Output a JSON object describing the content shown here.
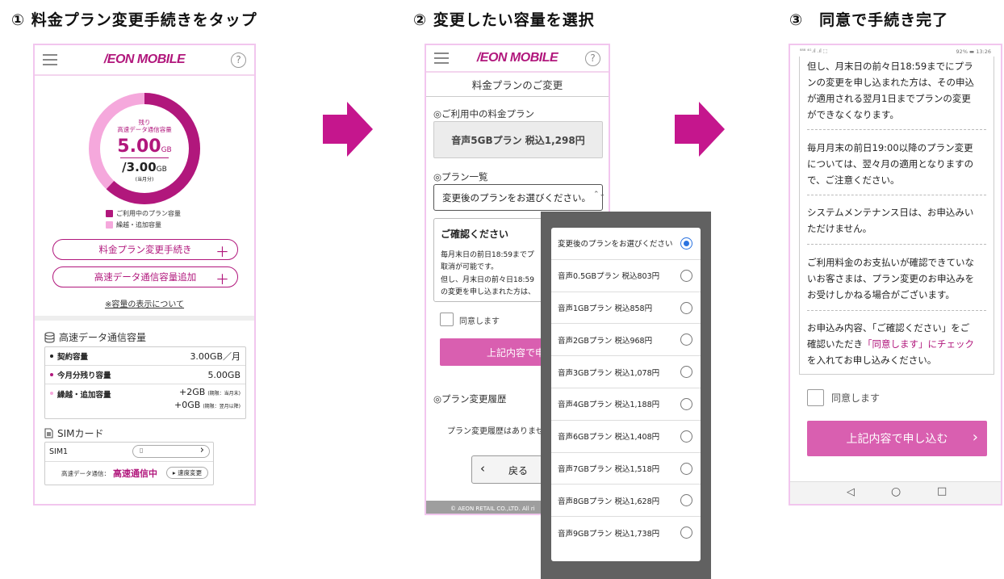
{
  "steps": {
    "s1": "① 料金プラン変更手続きをタップ",
    "s2": "② 変更したい容量を選択",
    "s3": "③　同意で手続き完了"
  },
  "brand": {
    "logo": "/EON MOBILE",
    "help_icon": "?"
  },
  "colors": {
    "magenta": "#b1177c",
    "pink": "#f5a8dc",
    "button": "#d95fb0",
    "radio_blue": "#2b73e0",
    "arrow": "#c5168d"
  },
  "p1": {
    "donut": {
      "remaining_label_1": "残り",
      "remaining_label_2": "高速データ通信容量",
      "remaining_value": "5.00",
      "remaining_unit": "GB",
      "total_value": "/3.00",
      "total_unit": "GB",
      "total_note": "(当月分)",
      "remaining_fraction": 0.62
    },
    "legend": [
      {
        "label": "ご利用中のプラン容量",
        "color": "#b1177c"
      },
      {
        "label": "繰越・追加容量",
        "color": "#f5a8dc"
      }
    ],
    "btn_plan_change": "料金プラン変更手続き",
    "btn_add_data": "高速データ通信容量追加",
    "plus": "＋",
    "capacity_link": "※容量の表示について",
    "capacity_title": "高速データ通信容量",
    "rows": {
      "contract_label": "契約容量",
      "contract_value": "3.00GB／月",
      "remaining_label": "今月分残り容量",
      "remaining_value": "5.00GB",
      "carry_label": "繰越・追加容量",
      "carry_value_1": "+2GB",
      "carry_note_1": "(期限：当月末)",
      "carry_value_2": "+0GB",
      "carry_note_2": "(期限：翌月以降)"
    },
    "sim_title": "SIMカード",
    "sim1": "SIM1",
    "sim_chevron": "›",
    "speed_label": "高速データ通信：",
    "speed_status": "高速通信中",
    "speed_btn": "▸ 速度変更"
  },
  "p2": {
    "page_title": "料金プランのご変更",
    "current_label": "◎ご利用中の料金プラン",
    "current_plan": "音声5GBプラン 税込1,298円",
    "list_label": "◎プラン一覧",
    "select_placeholder": "変更後のプランをお選びください。",
    "select_arrows": "⌃⌄",
    "confirm_title": "ご確認ください",
    "confirm_line1": "毎月末日の前日18:59までプ",
    "confirm_line2": "取消が可能です。",
    "confirm_line3": "但し、月末日の前々日18:59",
    "confirm_line4": "の変更を申し込まれた方は、",
    "agree": "同意します",
    "submit_partial": "上記内容で申し",
    "history_label": "◎プラン変更履歴",
    "history_empty": "プラン変更履歴はありませ",
    "back_chevron": "‹",
    "back": "戻る",
    "footer": "© AEON RETAIL CO.,LTD. All ri"
  },
  "dropdown": {
    "options": [
      {
        "label": "変更後のプランをお選びください",
        "selected": true
      },
      {
        "label": "音声0.5GBプラン 税込803円",
        "selected": false
      },
      {
        "label": "音声1GBプラン 税込858円",
        "selected": false
      },
      {
        "label": "音声2GBプラン 税込968円",
        "selected": false
      },
      {
        "label": "音声3GBプラン 税込1,078円",
        "selected": false
      },
      {
        "label": "音声4GBプラン 税込1,188円",
        "selected": false
      },
      {
        "label": "音声6GBプラン 税込1,408円",
        "selected": false
      },
      {
        "label": "音声7GBプラン 税込1,518円",
        "selected": false
      },
      {
        "label": "音声8GBプラン 税込1,628円",
        "selected": false
      },
      {
        "label": "音声9GBプラン 税込1,738円",
        "selected": false
      }
    ]
  },
  "p3": {
    "status_left": "⁸⁸⁸ ⁴ᴳ.ıl .ıl ⬚",
    "status_right": "92% ▬ 13:26",
    "para1_l1": "但し、月末日の前々日18:59までにプラ",
    "para1_l2": "ンの変更を申し込まれた方は、その申込",
    "para1_l3": "が適用される翌月1日までプランの変更",
    "para1_l4": "ができなくなります。",
    "para2_l1": "毎月月末の前日19:00以降のプラン変更",
    "para2_l2": "については、翌々月の適用となりますの",
    "para2_l3": "で、ご注意ください。",
    "para3_l1": "システムメンテナンス日は、お申込みい",
    "para3_l2": "ただけません。",
    "para4_l1": "ご利用料金のお支払いが確認できていな",
    "para4_l2": "いお客さまは、プラン変更のお申込みを",
    "para4_l3": "お受けしかねる場合がございます。",
    "para5_l1": "お申込み内容、「ご確認ください」をご",
    "para5_l2a": "確認いただき",
    "para5_l2b": "「同意します」にチェック",
    "para5_l3": "を入れてお申し込みください。",
    "agree": "同意します",
    "submit": "上記内容で申し込む",
    "submit_chevron": "›",
    "nav_back": "◁",
    "nav_home": "○",
    "nav_recent": "□"
  }
}
